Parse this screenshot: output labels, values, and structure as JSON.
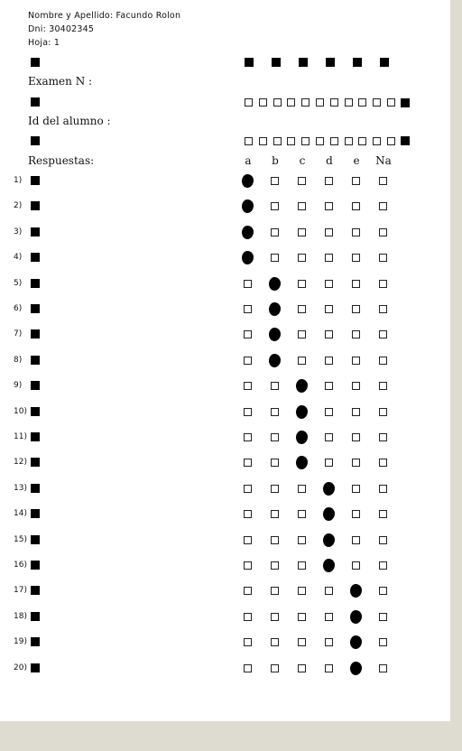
{
  "header": {
    "name_line": "Nombre y Apellido: Facundo Rolon",
    "dni_line": "Dni: 30402345",
    "page_line": "Hoja: 1"
  },
  "labels": {
    "exam": "Examen N :",
    "student_id": "Id del alumno :",
    "answers": "Respuestas:"
  },
  "columns": [
    "a",
    "b",
    "c",
    "d",
    "e",
    "Na"
  ],
  "exam_code_boxes": 11,
  "student_id_boxes": 11,
  "questions": [
    {
      "label": "1)",
      "answer": "a"
    },
    {
      "label": "2)",
      "answer": "a"
    },
    {
      "label": "3)",
      "answer": "a"
    },
    {
      "label": "4)",
      "answer": "a"
    },
    {
      "label": "5)",
      "answer": "b"
    },
    {
      "label": "6)",
      "answer": "b"
    },
    {
      "label": "7)",
      "answer": "b"
    },
    {
      "label": "8)",
      "answer": "b"
    },
    {
      "label": "9)",
      "answer": "c"
    },
    {
      "label": "10)",
      "answer": "c"
    },
    {
      "label": "11)",
      "answer": "c"
    },
    {
      "label": "12)",
      "answer": "c"
    },
    {
      "label": "13)",
      "answer": "d"
    },
    {
      "label": "14)",
      "answer": "d"
    },
    {
      "label": "15)",
      "answer": "d"
    },
    {
      "label": "16)",
      "answer": "d"
    },
    {
      "label": "17)",
      "answer": "e"
    },
    {
      "label": "18)",
      "answer": "e"
    },
    {
      "label": "19)",
      "answer": "e"
    },
    {
      "label": "20)",
      "answer": "e"
    }
  ]
}
